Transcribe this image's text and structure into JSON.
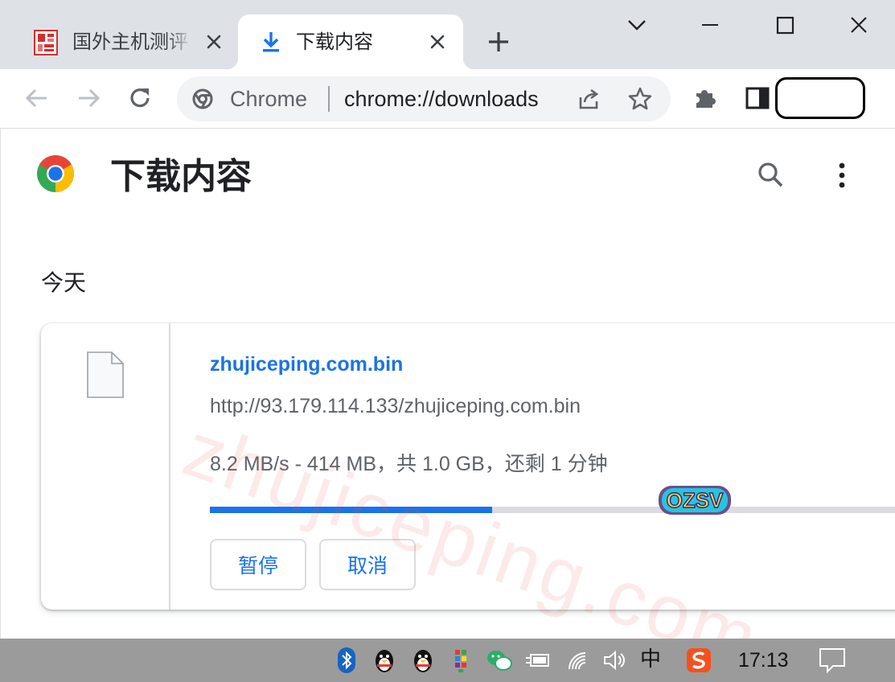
{
  "window": {
    "tabs": [
      {
        "title": "国外主机测评",
        "icon": "site-seal-icon"
      },
      {
        "title": "下载内容",
        "icon": "download-arrow-icon"
      }
    ],
    "controls": [
      "tab-search-icon",
      "minimize-icon",
      "maximize-icon",
      "close-icon"
    ]
  },
  "toolbar": {
    "omnibox_chip": "Chrome",
    "omnibox_url": "chrome://downloads",
    "icons": [
      "back-arrow-icon",
      "forward-arrow-icon",
      "reload-icon",
      "share-icon",
      "star-icon",
      "puzzle-extension-icon",
      "side-panel-icon"
    ]
  },
  "page": {
    "title": "下载内容",
    "section_today": "今天",
    "download": {
      "file_name": "zhujiceping.com.bin",
      "url": "http://93.179.114.133/zhujiceping.com.bin",
      "status": "8.2 MB/s - 414 MB，共 1.0 GB，还剩 1 分钟",
      "progress_percent": 40.4,
      "pause_label": "暂停",
      "cancel_label": "取消"
    },
    "watermark": "zhujiceping.com",
    "stamp_text": "OZSV"
  },
  "taskbar": {
    "ime_label": "中",
    "clock": "17:13"
  },
  "colors": {
    "accent": "#1a73e8",
    "tabstrip": "#dee1e6",
    "taskbar": "#9b9b9b"
  }
}
